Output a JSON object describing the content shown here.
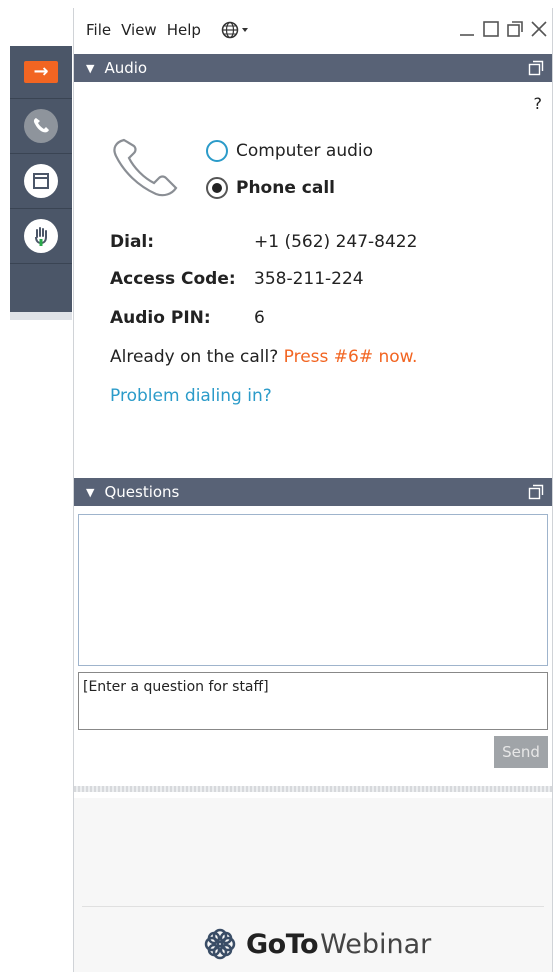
{
  "menu": {
    "file": "File",
    "view": "View",
    "help": "Help"
  },
  "audio": {
    "title": "Audio",
    "help_mark": "?",
    "option_computer": "Computer audio",
    "option_phone": "Phone call",
    "dial_label": "Dial:",
    "dial_value": "+1 (562) 247-8422",
    "access_label": "Access Code:",
    "access_value": "358-211-224",
    "pin_label": "Audio PIN:",
    "pin_value": "6",
    "already_text": "Already on the call?",
    "press_text": "Press #6# now.",
    "problem_link": "Problem dialing in?"
  },
  "questions": {
    "title": "Questions",
    "input_value": "[Enter a question for staff]",
    "send_label": "Send"
  },
  "brand": {
    "goto": "GoTo",
    "webinar": "Webinar"
  },
  "colors": {
    "accent": "#f26522",
    "link": "#2b9bc9",
    "header": "#586276",
    "tab": "#4b5668"
  }
}
